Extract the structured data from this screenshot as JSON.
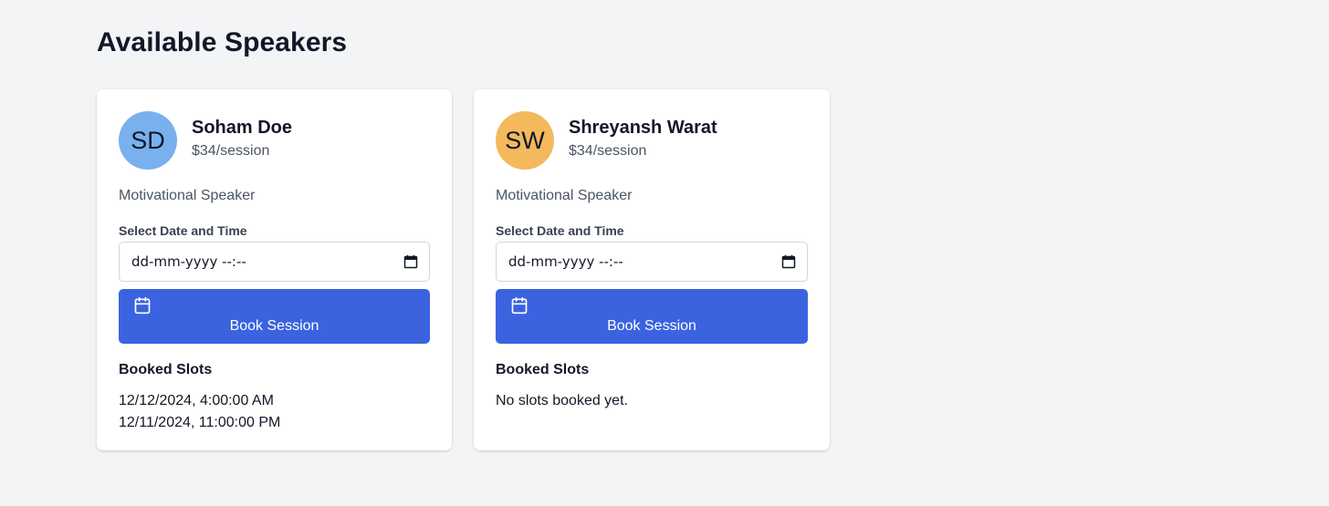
{
  "page": {
    "title": "Available Speakers"
  },
  "speakers": [
    {
      "initials": "SD",
      "avatar_color": "#79b0ee",
      "name": "Soham Doe",
      "price": "$34/session",
      "role": "Motivational Speaker",
      "date_label": "Select Date and Time",
      "date_placeholder": "dd-mm-yyyy --:--",
      "book_label": "Book Session",
      "booked_title": "Booked Slots",
      "slots": [
        "12/12/2024, 4:00:00 AM",
        "12/11/2024, 11:00:00 PM"
      ]
    },
    {
      "initials": "SW",
      "avatar_color": "#f3b95c",
      "name": "Shreyansh Warat",
      "price": "$34/session",
      "role": "Motivational Speaker",
      "date_label": "Select Date and Time",
      "date_placeholder": "dd-mm-yyyy --:--",
      "book_label": "Book Session",
      "booked_title": "Booked Slots",
      "empty_text": "No slots booked yet."
    }
  ],
  "colors": {
    "page_bg": "#f3f4f6",
    "button": "#3b63e0"
  },
  "icons": {
    "button_icon": "calendar-icon",
    "input_icon": "calendar-icon"
  }
}
